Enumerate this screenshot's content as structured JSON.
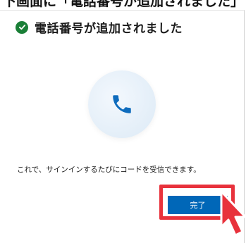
{
  "banner": {
    "text": "下画面に「電話番号が追加されました」と表示されるので「完了」を選択"
  },
  "dialog": {
    "title": "電話番号が追加されました",
    "message": "これで、サインインするたびにコードを受信できます。",
    "done_label": "完了"
  },
  "icons": [
    "check-icon",
    "phone-icon",
    "pointer-arrow-icon"
  ],
  "colors": {
    "success": "#1a7f37",
    "accent": "#0067b8",
    "highlight": "#e8323c"
  }
}
